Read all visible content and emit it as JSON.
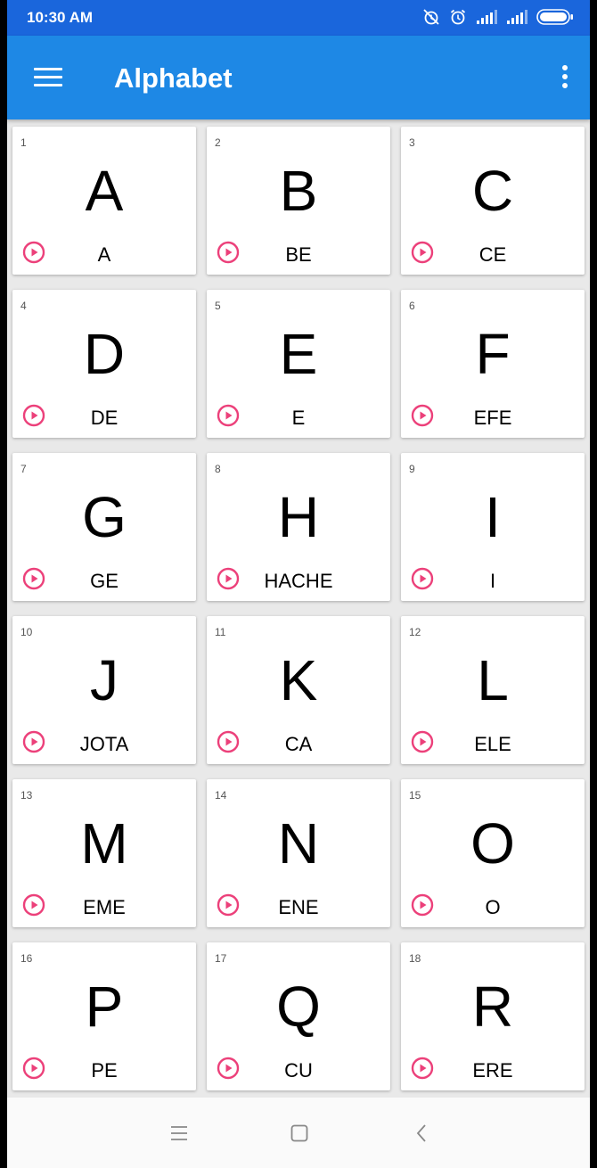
{
  "status_bar": {
    "time": "10:30 AM",
    "icons": [
      "alarm-off-icon",
      "alarm-icon",
      "signal-icon",
      "signal-icon",
      "battery-icon"
    ]
  },
  "app_bar": {
    "title": "Alphabet",
    "menu_icon": "hamburger-menu-icon",
    "more_icon": "more-vertical-icon"
  },
  "colors": {
    "status_bar": "#1a66dc",
    "app_bar": "#1e88e5",
    "play_icon": "#ec407a",
    "background": "#e9e9e9"
  },
  "cards": [
    {
      "number": "1",
      "letter": "A",
      "name": "A"
    },
    {
      "number": "2",
      "letter": "B",
      "name": "BE"
    },
    {
      "number": "3",
      "letter": "C",
      "name": "CE"
    },
    {
      "number": "4",
      "letter": "D",
      "name": "DE"
    },
    {
      "number": "5",
      "letter": "E",
      "name": "E"
    },
    {
      "number": "6",
      "letter": "F",
      "name": "EFE"
    },
    {
      "number": "7",
      "letter": "G",
      "name": "GE"
    },
    {
      "number": "8",
      "letter": "H",
      "name": "HACHE"
    },
    {
      "number": "9",
      "letter": "I",
      "name": "I"
    },
    {
      "number": "10",
      "letter": "J",
      "name": "JOTA"
    },
    {
      "number": "11",
      "letter": "K",
      "name": "CA"
    },
    {
      "number": "12",
      "letter": "L",
      "name": "ELE"
    },
    {
      "number": "13",
      "letter": "M",
      "name": "EME"
    },
    {
      "number": "14",
      "letter": "N",
      "name": "ENE"
    },
    {
      "number": "15",
      "letter": "O",
      "name": "O"
    },
    {
      "number": "16",
      "letter": "P",
      "name": "PE"
    },
    {
      "number": "17",
      "letter": "Q",
      "name": "CU"
    },
    {
      "number": "18",
      "letter": "R",
      "name": "ERE"
    }
  ],
  "nav_bar": {
    "icons": [
      "recents-icon",
      "home-icon",
      "back-icon"
    ]
  }
}
